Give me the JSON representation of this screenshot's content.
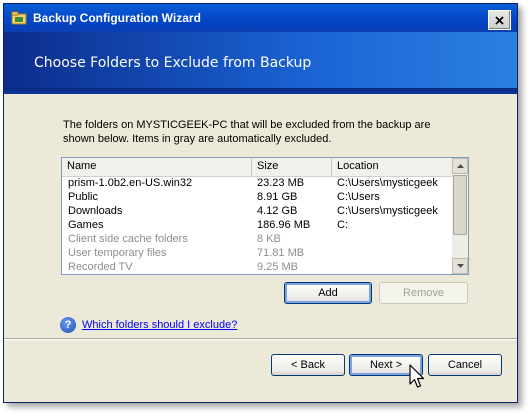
{
  "window": {
    "title": "Backup Configuration Wizard",
    "close_label": "✕"
  },
  "header": {
    "title": "Choose Folders to Exclude from  Backup"
  },
  "content": {
    "description": "The folders on MYSTICGEEK-PC that will be excluded from the backup are shown below. Items in gray are automatically excluded."
  },
  "list": {
    "columns": [
      "Name",
      "Size",
      "Location"
    ],
    "rows": [
      {
        "name": "prism-1.0b2.en-US.win32",
        "size": "23.23 MB",
        "location": "C:\\Users\\mysticgeek",
        "gray": false
      },
      {
        "name": "Public",
        "size": "8.91 GB",
        "location": "C:\\Users",
        "gray": false
      },
      {
        "name": "Downloads",
        "size": "4.12 GB",
        "location": "C:\\Users\\mysticgeek",
        "gray": false
      },
      {
        "name": "Games",
        "size": "186.96 MB",
        "location": "C:",
        "gray": false
      },
      {
        "name": "Client side cache folders",
        "size": "8 KB",
        "location": "",
        "gray": true
      },
      {
        "name": "User temporary files",
        "size": "71.81 MB",
        "location": "",
        "gray": true
      },
      {
        "name": "Recorded TV",
        "size": "9.25 MB",
        "location": "",
        "gray": true
      }
    ]
  },
  "buttons": {
    "add": "Add",
    "remove": "Remove",
    "back": "< Back",
    "next": "Next >",
    "cancel": "Cancel"
  },
  "help": {
    "icon": "?",
    "link": "Which folders should I exclude?"
  },
  "icons": {
    "window": "backup-wizard-icon",
    "help": "question-mark-icon",
    "cursor": "mouse-pointer-icon"
  },
  "colors": {
    "titlebar": "#0346c6",
    "header_dark": "#0c2c8c",
    "header_light": "#2b7fe2",
    "dialog_bg": "#ece9d8",
    "gray_text": "#8e8e8e",
    "link": "#0000ff"
  }
}
